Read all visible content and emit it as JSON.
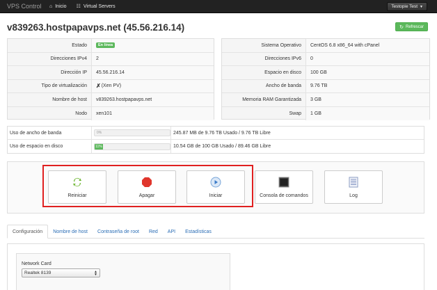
{
  "navbar": {
    "brand": "VPS Control",
    "links": [
      {
        "label": "Inicio",
        "icon": "home-icon"
      },
      {
        "label": "Virtual Servers",
        "icon": "grid-icon"
      }
    ],
    "user": "Testopie Test"
  },
  "header": {
    "title": "v839263.hostpapavps.net (45.56.216.14)",
    "refresh_label": "Refrescar"
  },
  "info_left": [
    {
      "label": "Estado",
      "value": "En línea",
      "type": "badge"
    },
    {
      "label": "Direcciones IPv4",
      "value": "2"
    },
    {
      "label": "Dirección IP",
      "value": "45.56.216.14"
    },
    {
      "label": "Tipo de virtualización",
      "value": "(Xen PV)",
      "type": "xen"
    },
    {
      "label": "Nombre de host",
      "value": "v839263.hostpapavps.net"
    },
    {
      "label": "Nodo",
      "value": "xen101"
    }
  ],
  "info_right": [
    {
      "label": "Sistema Operativo",
      "value": "CentOS 6.8 x86_64 with cPanel"
    },
    {
      "label": "Direcciones IPv6",
      "value": "0"
    },
    {
      "label": "Espacio en disco",
      "value": "100 GB"
    },
    {
      "label": "Ancho de banda",
      "value": "9.76 TB"
    },
    {
      "label": "Memoria RAM Garantizada",
      "value": "3 GB"
    },
    {
      "label": "Swap",
      "value": "1 GB"
    }
  ],
  "usage": [
    {
      "label": "Uso de ancho de banda",
      "percent": 0,
      "bar_text": "0%",
      "text": "245.87 MB de 9.76 TB Usado / 9.76 TB Libre"
    },
    {
      "label": "Uso de espacio en disco",
      "percent": 11,
      "bar_text": "11%",
      "text": "10.54 GB de 100 GB Usado / 89.46 GB Libre"
    }
  ],
  "actions": [
    {
      "label": "Reiniciar",
      "icon": "reboot-icon"
    },
    {
      "label": "Apagar",
      "icon": "stop-icon"
    },
    {
      "label": "Iniciar",
      "icon": "play-icon"
    },
    {
      "label": "Consola de comandos",
      "icon": "console-icon"
    },
    {
      "label": "Log",
      "icon": "log-icon"
    }
  ],
  "tabs": [
    "Configuración",
    "Nombre de host",
    "Contraseña de root",
    "Red",
    "API",
    "Estadísticas"
  ],
  "config": {
    "network_card_label": "Network Card",
    "network_card_value": "Realtek 8139"
  },
  "colors": {
    "navbar": "#222222",
    "success": "#5cb85c",
    "link": "#2a6db5",
    "highlight": "#e02020"
  }
}
